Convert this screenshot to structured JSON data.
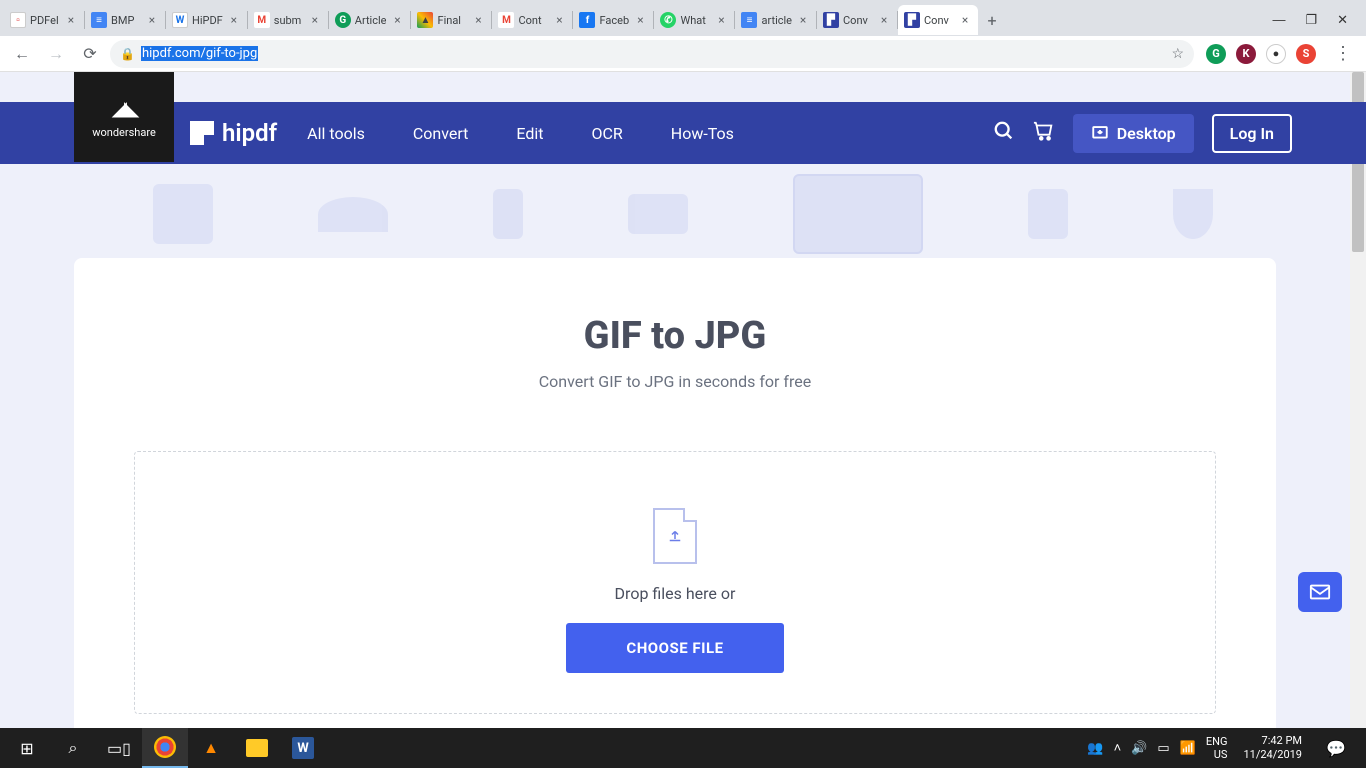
{
  "browser": {
    "tabs": [
      {
        "title": "PDFel",
        "favicon": "fav-pdfel",
        "faviconChar": "▫"
      },
      {
        "title": "BMP",
        "favicon": "fav-docs",
        "faviconChar": "≡"
      },
      {
        "title": "HiPDF",
        "favicon": "fav-w",
        "faviconChar": "W"
      },
      {
        "title": "subm",
        "favicon": "fav-gmail",
        "faviconChar": "M"
      },
      {
        "title": "Article",
        "favicon": "fav-g",
        "faviconChar": "G"
      },
      {
        "title": "Final",
        "favicon": "fav-drive",
        "faviconChar": "▲"
      },
      {
        "title": "Cont",
        "favicon": "fav-gmail",
        "faviconChar": "M"
      },
      {
        "title": "Faceb",
        "favicon": "fav-fb",
        "faviconChar": "f"
      },
      {
        "title": "What",
        "favicon": "fav-wa",
        "faviconChar": "✆"
      },
      {
        "title": "article",
        "favicon": "fav-docs",
        "faviconChar": "≡"
      },
      {
        "title": "Conv",
        "favicon": "fav-hipdf",
        "faviconChar": "▛"
      },
      {
        "title": "Conv",
        "favicon": "fav-hipdf",
        "faviconChar": "▛",
        "active": true
      }
    ],
    "url": "hipdf.com/gif-to-jpg"
  },
  "site": {
    "wondershare": "wondershare",
    "logoText": "hipdf",
    "nav": {
      "allTools": "All tools",
      "convert": "Convert",
      "edit": "Edit",
      "ocr": "OCR",
      "howTos": "How-Tos"
    },
    "desktop": "Desktop",
    "login": "Log In"
  },
  "page": {
    "title": "GIF to JPG",
    "subtitle": "Convert GIF to JPG in seconds for free",
    "dropText": "Drop files here or",
    "chooseBtn": "CHOOSE FILE"
  },
  "taskbar": {
    "lang1": "ENG",
    "lang2": "US",
    "time": "7:42 PM",
    "date": "11/24/2019"
  }
}
